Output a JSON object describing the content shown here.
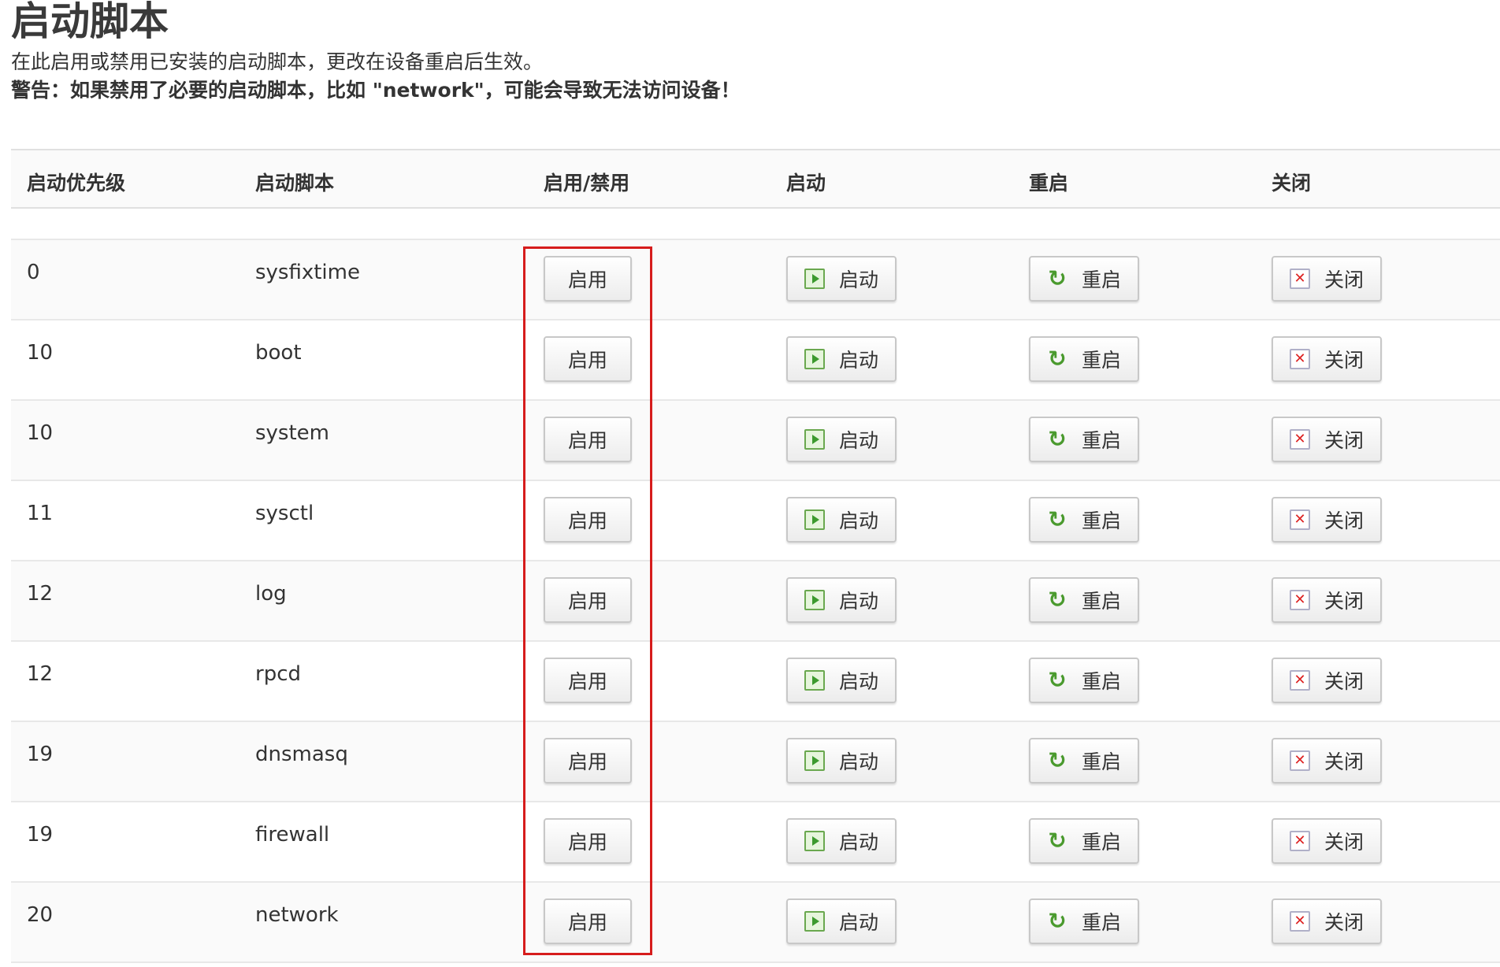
{
  "title": "启动脚本",
  "description": "在此启用或禁用已安装的启动脚本，更改在设备重启后生效。",
  "warning": "警告：如果禁用了必要的启动脚本，比如 \"network\"，可能会导致无法访问设备！",
  "columns": {
    "priority": "启动优先级",
    "script": "启动脚本",
    "toggle": "启用/禁用",
    "start": "启动",
    "restart": "重启",
    "stop": "关闭"
  },
  "buttons": {
    "enable": "启用",
    "start": "启动",
    "restart": "重启",
    "stop": "关闭"
  },
  "icons": {
    "start": "play-icon",
    "restart": "refresh-icon",
    "stop": "close-icon"
  },
  "highlight_color": "#d61c1c",
  "rows": [
    {
      "priority": "0",
      "name": "sysfixtime"
    },
    {
      "priority": "10",
      "name": "boot"
    },
    {
      "priority": "10",
      "name": "system"
    },
    {
      "priority": "11",
      "name": "sysctl"
    },
    {
      "priority": "12",
      "name": "log"
    },
    {
      "priority": "12",
      "name": "rpcd"
    },
    {
      "priority": "19",
      "name": "dnsmasq"
    },
    {
      "priority": "19",
      "name": "firewall"
    },
    {
      "priority": "20",
      "name": "network"
    }
  ]
}
